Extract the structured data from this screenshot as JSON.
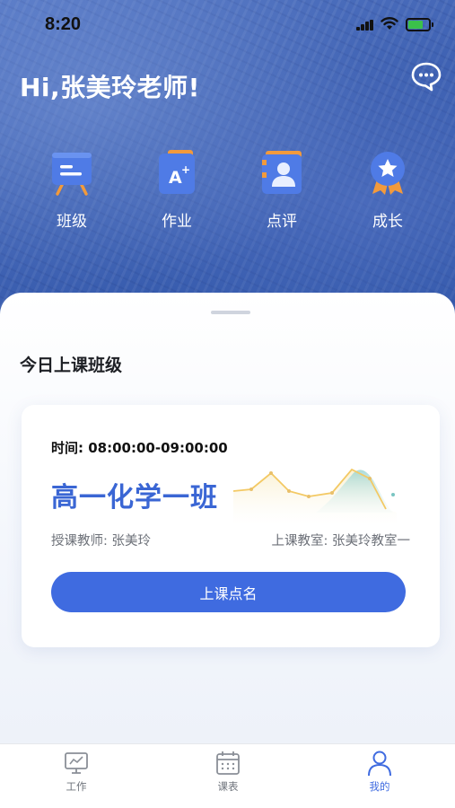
{
  "status_bar": {
    "time": "8:20"
  },
  "header": {
    "greeting": "Hi,张美玲老师!"
  },
  "quick_nav": [
    {
      "label": "班级",
      "icon": "class-board-icon"
    },
    {
      "label": "作业",
      "icon": "homework-icon"
    },
    {
      "label": "点评",
      "icon": "review-icon"
    },
    {
      "label": "成长",
      "icon": "growth-medal-icon"
    }
  ],
  "today": {
    "section_title": "今日上课班级",
    "card": {
      "time_label": "时间:",
      "time_value": "08:00:00-09:00:00",
      "class_name": "高一化学一班",
      "teacher_label": "授课教师:",
      "teacher_name": "张美玲",
      "room_label": "上课教室:",
      "room_name": "张美玲教室一",
      "rollcall_button": "上课点名"
    }
  },
  "tabbar": [
    {
      "label": "工作",
      "icon": "monitor-icon",
      "active": false
    },
    {
      "label": "课表",
      "icon": "calendar-icon",
      "active": false
    },
    {
      "label": "我的",
      "icon": "user-icon",
      "active": true
    }
  ],
  "colors": {
    "accent": "#3f6be0",
    "class_name": "#3a66d4",
    "hero": "#3f62b3"
  }
}
